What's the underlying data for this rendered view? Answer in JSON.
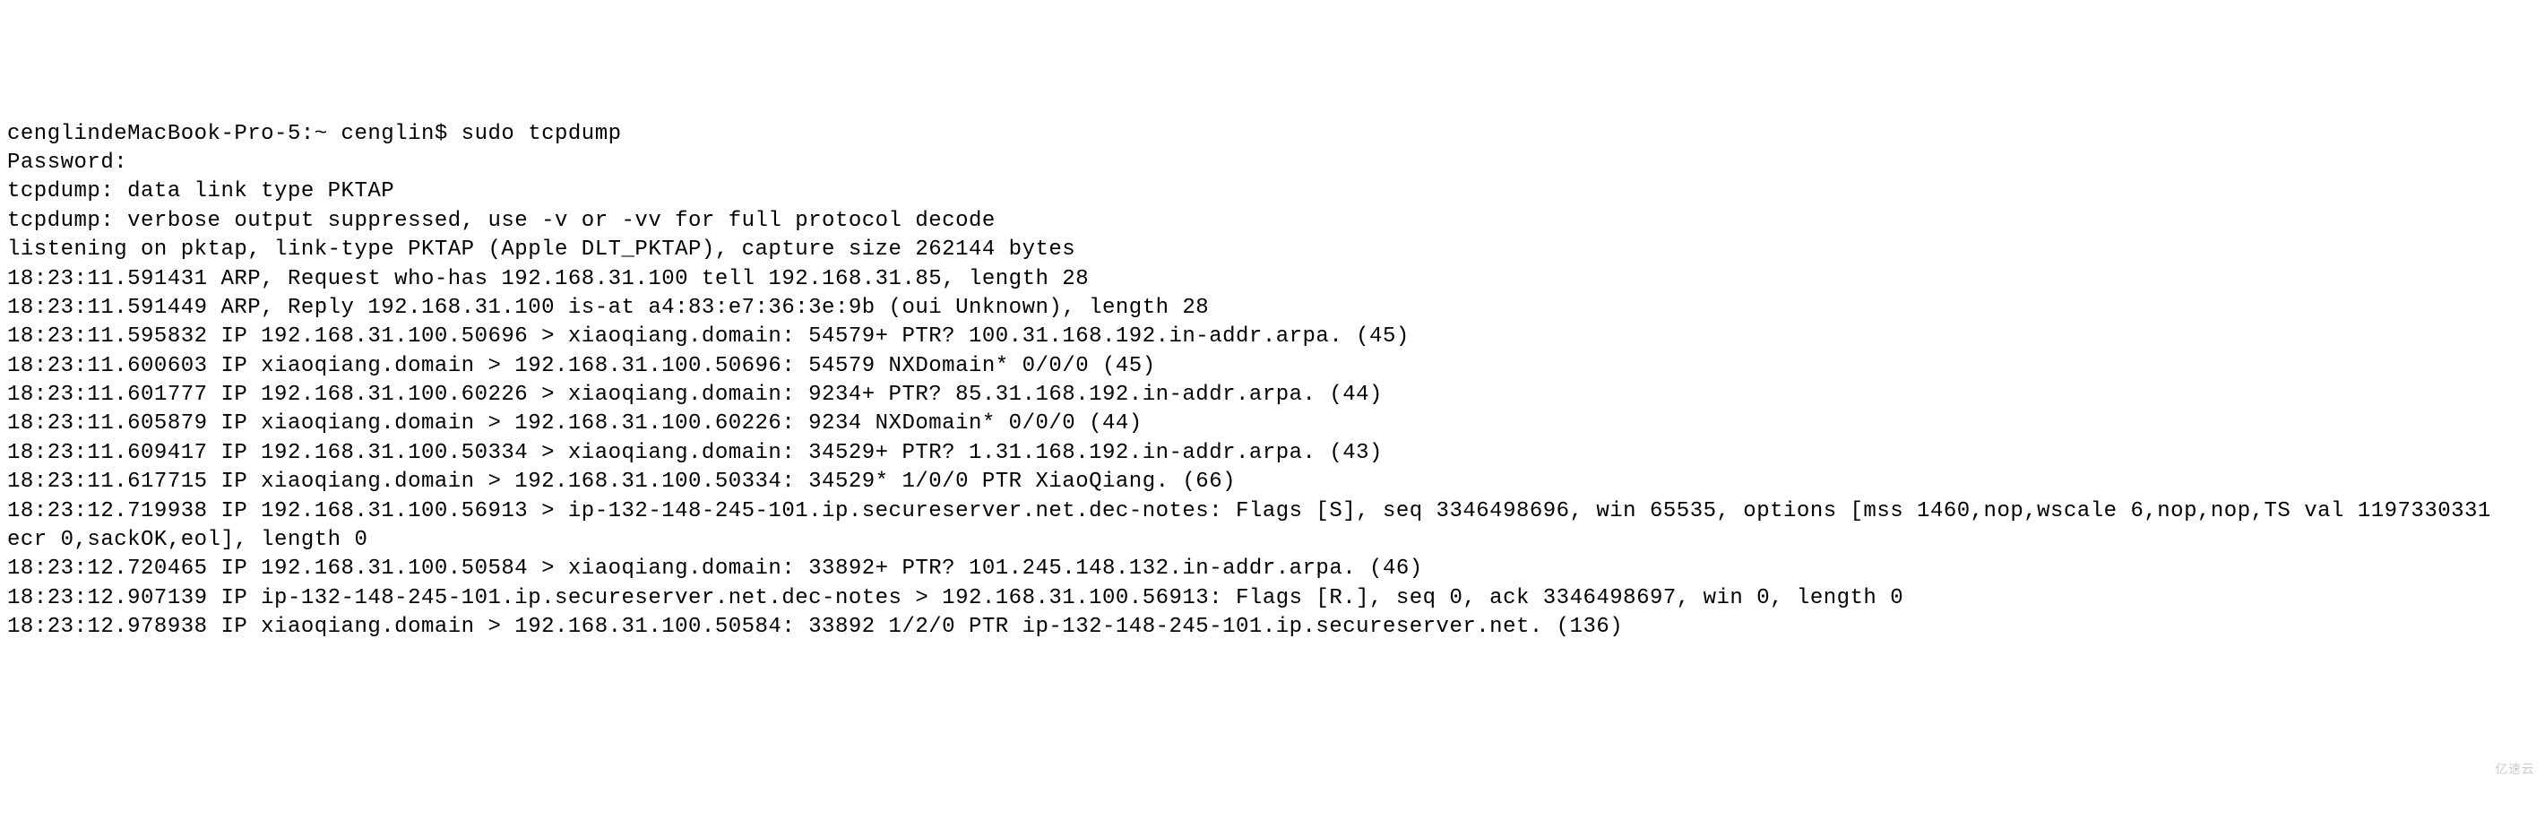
{
  "terminal": {
    "lines": [
      "cenglindeMacBook-Pro-5:~ cenglin$ sudo tcpdump",
      "Password:",
      "tcpdump: data link type PKTAP",
      "tcpdump: verbose output suppressed, use -v or -vv for full protocol decode",
      "listening on pktap, link-type PKTAP (Apple DLT_PKTAP), capture size 262144 bytes",
      "18:23:11.591431 ARP, Request who-has 192.168.31.100 tell 192.168.31.85, length 28",
      "18:23:11.591449 ARP, Reply 192.168.31.100 is-at a4:83:e7:36:3e:9b (oui Unknown), length 28",
      "18:23:11.595832 IP 192.168.31.100.50696 > xiaoqiang.domain: 54579+ PTR? 100.31.168.192.in-addr.arpa. (45)",
      "18:23:11.600603 IP xiaoqiang.domain > 192.168.31.100.50696: 54579 NXDomain* 0/0/0 (45)",
      "18:23:11.601777 IP 192.168.31.100.60226 > xiaoqiang.domain: 9234+ PTR? 85.31.168.192.in-addr.arpa. (44)",
      "18:23:11.605879 IP xiaoqiang.domain > 192.168.31.100.60226: 9234 NXDomain* 0/0/0 (44)",
      "18:23:11.609417 IP 192.168.31.100.50334 > xiaoqiang.domain: 34529+ PTR? 1.31.168.192.in-addr.arpa. (43)",
      "18:23:11.617715 IP xiaoqiang.domain > 192.168.31.100.50334: 34529* 1/0/0 PTR XiaoQiang. (66)",
      "18:23:12.719938 IP 192.168.31.100.56913 > ip-132-148-245-101.ip.secureserver.net.dec-notes: Flags [S], seq 3346498696, win 65535, options [mss 1460,nop,wscale 6,nop,nop,TS val 1197330331 ecr 0,sackOK,eol], length 0",
      "18:23:12.720465 IP 192.168.31.100.50584 > xiaoqiang.domain: 33892+ PTR? 101.245.148.132.in-addr.arpa. (46)",
      "18:23:12.907139 IP ip-132-148-245-101.ip.secureserver.net.dec-notes > 192.168.31.100.56913: Flags [R.], seq 0, ack 3346498697, win 0, length 0",
      "18:23:12.978938 IP xiaoqiang.domain > 192.168.31.100.50584: 33892 1/2/0 PTR ip-132-148-245-101.ip.secureserver.net. (136)"
    ]
  },
  "watermark": "亿速云"
}
